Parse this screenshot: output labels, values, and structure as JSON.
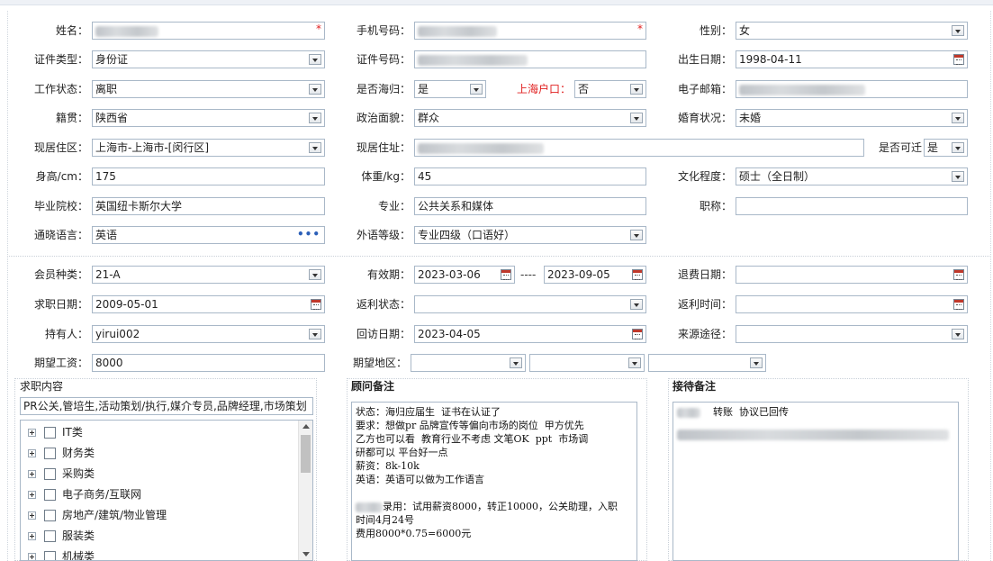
{
  "personal": {
    "name": {
      "label": "姓名："
    },
    "phone": {
      "label": "手机号码："
    },
    "gender": {
      "label": "性别：",
      "value": "女"
    },
    "id_type": {
      "label": "证件类型：",
      "value": "身份证"
    },
    "id_number": {
      "label": "证件号码："
    },
    "birth_date": {
      "label": "出生日期：",
      "value": "1998-04-11"
    },
    "work_status": {
      "label": "工作状态：",
      "value": "离职"
    },
    "returnee": {
      "label": "是否海归：",
      "value": "是"
    },
    "shanghai_hukou": {
      "label": "上海户口：",
      "value": "否"
    },
    "email": {
      "label": "电子邮箱："
    },
    "native_place": {
      "label": "籍贯：",
      "value": "陕西省"
    },
    "political_status": {
      "label": "政治面貌：",
      "value": "群众"
    },
    "marital_status": {
      "label": "婚育状况：",
      "value": "未婚"
    },
    "current_area": {
      "label": "现居住区：",
      "value": "上海市-上海市-[闵行区]"
    },
    "current_address": {
      "label": "现居住址："
    },
    "relocatable": {
      "label": "是否可迁",
      "value": "是"
    },
    "height": {
      "label": "身高/cm：",
      "value": "175"
    },
    "weight": {
      "label": "体重/kg：",
      "value": "45"
    },
    "education": {
      "label": "文化程度：",
      "value": "硕士（全日制）"
    },
    "school": {
      "label": "毕业院校：",
      "value": "英国纽卡斯尔大学"
    },
    "major": {
      "label": "专业：",
      "value": "公共关系和媒体"
    },
    "title": {
      "label": "职称：",
      "value": ""
    },
    "language": {
      "label": "通晓语言：",
      "value": "英语",
      "more": "•••"
    },
    "language_level": {
      "label": "外语等级：",
      "value": "专业四级（口语好）"
    }
  },
  "membership": {
    "member_type": {
      "label": "会员种类：",
      "value": "21-A"
    },
    "validity": {
      "label": "有效期：",
      "start": "2023-03-06",
      "separator": "----",
      "end": "2023-09-05"
    },
    "refund_date": {
      "label": "退费日期：",
      "value": ""
    },
    "job_seek_date": {
      "label": "求职日期：",
      "value": "2009-05-01"
    },
    "rebate_status": {
      "label": "返利状态：",
      "value": ""
    },
    "rebate_time": {
      "label": "返利时间：",
      "value": ""
    },
    "holder": {
      "label": "持有人：",
      "value": "yirui002"
    },
    "followup_date": {
      "label": "回访日期：",
      "value": "2023-04-05"
    },
    "source": {
      "label": "来源途径：",
      "value": ""
    },
    "expected_salary": {
      "label": "期望工资：",
      "value": "8000"
    },
    "expected_region": {
      "label": "期望地区：",
      "values": [
        "",
        "",
        ""
      ]
    }
  },
  "job_intent": {
    "title": "求职内容",
    "selected": "PR公关,管培生,活动策划/执行,媒介专员,品牌经理,市场策划",
    "categories": [
      {
        "label": "IT类"
      },
      {
        "label": "财务类"
      },
      {
        "label": "采购类"
      },
      {
        "label": "电子商务/互联网"
      },
      {
        "label": "房地产/建筑/物业管理"
      },
      {
        "label": "服装类"
      },
      {
        "label": "机械类"
      }
    ]
  },
  "consultant_notes": {
    "title": "顾问备注",
    "lines": [
      "状态：海归应届生  证书在认证了",
      "要求：想做pr 品牌宣传等偏向市场的岗位  甲方优先",
      "乙方也可以看  教育行业不考虑 文笔OK  ppt  市场调",
      "研都可以 平台好一点",
      "薪资：8k-10k",
      "英语：英语可以做为工作语言",
      "",
      "录用：试用薪资8000，转正10000，公关助理，入职",
      "时间4月24号",
      "费用8000*0.75=6000元"
    ]
  },
  "reception_notes": {
    "title": "接待备注",
    "lines": [
      "转账  协议已回传"
    ]
  },
  "colors": {
    "border": "#a9b8c8",
    "required": "#e02020",
    "link": "#2b5fb8"
  }
}
